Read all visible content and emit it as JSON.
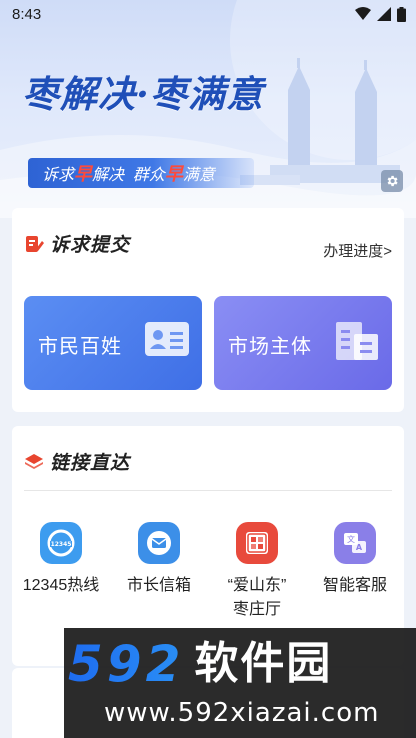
{
  "status_bar": {
    "time": "8:43"
  },
  "hero": {
    "title": "枣解决·枣满意",
    "slogan_part1": "诉求",
    "slogan_hl1": "早",
    "slogan_part2": "解决  群众",
    "slogan_hl2": "早",
    "slogan_part3": "满意"
  },
  "submit_section": {
    "title": "诉求提交",
    "progress_link": "办理进度>",
    "citizen_button": "市民百姓",
    "market_button": "市场主体"
  },
  "links_section": {
    "title": "链接直达",
    "items": [
      {
        "label": "12345热线",
        "icon": "hotline-icon"
      },
      {
        "label": "市长信箱",
        "icon": "mail-icon"
      },
      {
        "label": "“爱山东”\n枣庄厅",
        "icon": "aishandong-icon"
      },
      {
        "label": "智能客服",
        "icon": "translate-service-icon"
      }
    ]
  },
  "watermark": {
    "number": "592",
    "brand": "软件园",
    "url": "www.592xiazai.com"
  },
  "colors": {
    "primary_blue": "#3f6fe6",
    "purple": "#6a6ae8",
    "hero_title": "#1f4fb8",
    "accent_red": "#ff4a3a",
    "section_icon_red": "#e8452f",
    "watermark_blue": "#1e6cf0"
  }
}
